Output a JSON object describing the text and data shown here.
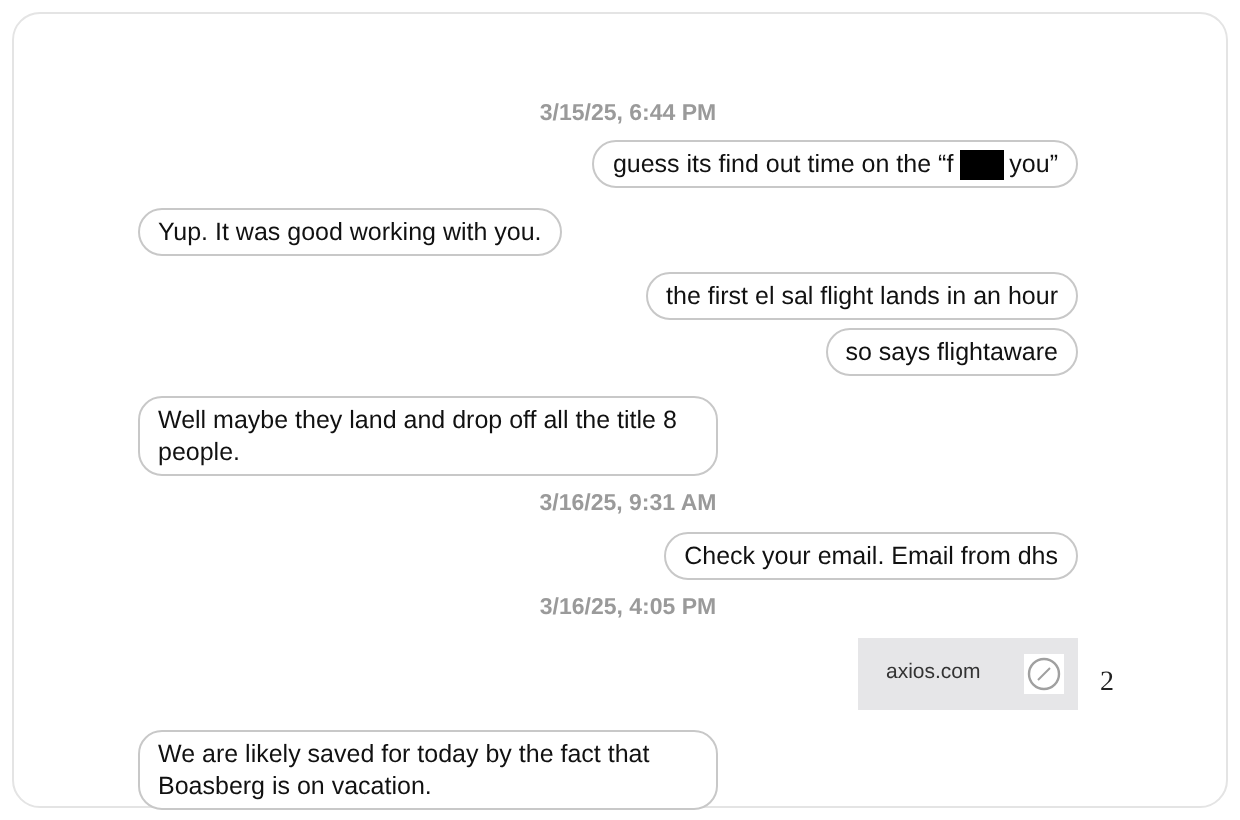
{
  "messages": [
    {
      "kind": "timestamp",
      "text": "3/15/25, 6:44 PM"
    },
    {
      "kind": "sent",
      "text": "guess its find out time on the “f",
      "redacted": true,
      "text_after": "you”"
    },
    {
      "kind": "received",
      "text": "Yup.  It was good working with you."
    },
    {
      "kind": "sent",
      "text": "the first el sal flight lands in an hour"
    },
    {
      "kind": "sent",
      "text": "so says flightaware"
    },
    {
      "kind": "received",
      "text": "Well maybe they land and drop off all the title 8 people."
    },
    {
      "kind": "timestamp",
      "text": "3/16/25, 9:31 AM"
    },
    {
      "kind": "sent",
      "text": "Check your email. Email from dhs"
    },
    {
      "kind": "timestamp",
      "text": "3/16/25, 4:05 PM"
    },
    {
      "kind": "link",
      "text": "axios.com"
    },
    {
      "kind": "received",
      "text": "We are likely saved for today by the fact that Boasberg is on vacation."
    }
  ],
  "page_number": "2"
}
